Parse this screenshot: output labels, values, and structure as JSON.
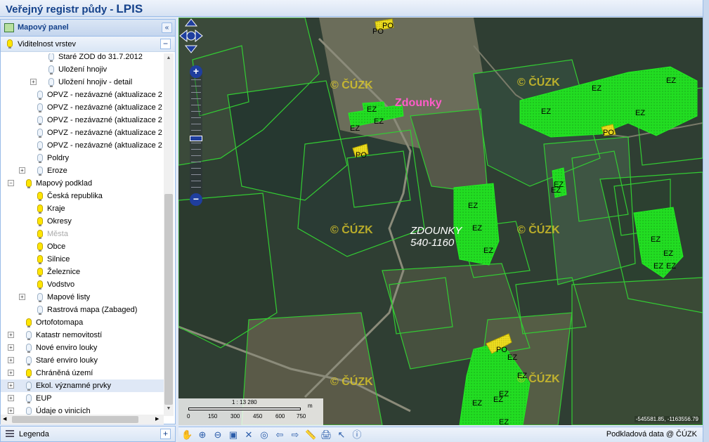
{
  "header": {
    "title_prefix": "Veřejný registr půdy -",
    "title_suffix": "LPIS"
  },
  "map_panel": {
    "title": "Mapový panel",
    "collapse": "«"
  },
  "layers": {
    "title": "Viditelnost vrstev",
    "collapse": "−"
  },
  "tree": [
    {
      "label": "Staré ZOD do 31.7.2012",
      "indent": 82,
      "bulb": "off",
      "exp": ""
    },
    {
      "label": "Uložení hnojiv",
      "indent": 82,
      "bulb": "off",
      "exp": ""
    },
    {
      "label": "Uložení hnojiv - detail",
      "indent": 82,
      "bulb": "off",
      "exp": "+"
    },
    {
      "label": "OPVZ - nezávazné (aktualizace 2",
      "indent": 66,
      "bulb": "off",
      "exp": ""
    },
    {
      "label": "OPVZ - nezávazné (aktualizace 2",
      "indent": 66,
      "bulb": "off",
      "exp": ""
    },
    {
      "label": "OPVZ - nezávazné (aktualizace 2",
      "indent": 66,
      "bulb": "off",
      "exp": ""
    },
    {
      "label": "OPVZ - nezávazné (aktualizace 2",
      "indent": 66,
      "bulb": "off",
      "exp": ""
    },
    {
      "label": "OPVZ - nezávazné (aktualizace 2",
      "indent": 66,
      "bulb": "off",
      "exp": ""
    },
    {
      "label": "Poldry",
      "indent": 66,
      "bulb": "off",
      "exp": ""
    },
    {
      "label": "Eroze",
      "indent": 66,
      "bulb": "off",
      "exp": "+"
    },
    {
      "label": "Mapový podklad",
      "indent": 50,
      "bulb": "on",
      "exp": "−"
    },
    {
      "label": "Česká republika",
      "indent": 66,
      "bulb": "on",
      "exp": ""
    },
    {
      "label": "Kraje",
      "indent": 66,
      "bulb": "on",
      "exp": ""
    },
    {
      "label": "Okresy",
      "indent": 66,
      "bulb": "on",
      "exp": ""
    },
    {
      "label": "Města",
      "indent": 66,
      "bulb": "on",
      "exp": "",
      "dim": true
    },
    {
      "label": "Obce",
      "indent": 66,
      "bulb": "on",
      "exp": ""
    },
    {
      "label": "Silnice",
      "indent": 66,
      "bulb": "on",
      "exp": ""
    },
    {
      "label": "Železnice",
      "indent": 66,
      "bulb": "on",
      "exp": ""
    },
    {
      "label": "Vodstvo",
      "indent": 66,
      "bulb": "on",
      "exp": ""
    },
    {
      "label": "Mapové listy",
      "indent": 66,
      "bulb": "off",
      "exp": "+"
    },
    {
      "label": "Rastrová mapa (Zabaged)",
      "indent": 66,
      "bulb": "off",
      "exp": ""
    },
    {
      "label": "Ortofotomapa",
      "indent": 50,
      "bulb": "on",
      "exp": ""
    },
    {
      "label": "Katastr nemovitostí",
      "indent": 50,
      "bulb": "off",
      "exp": "+"
    },
    {
      "label": "Nové enviro louky",
      "indent": 50,
      "bulb": "off",
      "exp": "+"
    },
    {
      "label": "Staré enviro louky",
      "indent": 50,
      "bulb": "off",
      "exp": "+"
    },
    {
      "label": "Chráněná území",
      "indent": 50,
      "bulb": "on",
      "exp": "+"
    },
    {
      "label": "Ekol. významné prvky",
      "indent": 50,
      "bulb": "off",
      "exp": "+",
      "selected": true
    },
    {
      "label": "EUP",
      "indent": 50,
      "bulb": "off",
      "exp": "+"
    },
    {
      "label": "Údaje o vinicích",
      "indent": 50,
      "bulb": "off",
      "exp": "+"
    }
  ],
  "legend": {
    "title": "Legenda",
    "expand": "+"
  },
  "map": {
    "town_label": "Zdounky",
    "parcel_name": "ZDOUNKY",
    "parcel_code": "540-1160",
    "watermark": "© ČÚZK",
    "ez": "EZ",
    "po": "PO",
    "scale": "1 : 13 280",
    "scale_unit": "m",
    "scale_ticks": [
      "0",
      "150",
      "300",
      "450",
      "600",
      "750"
    ],
    "coords": "-545581.85, -1163556.79",
    "zoom_in": "+",
    "zoom_out": "−"
  },
  "toolbar": {
    "copyright": "Podkladová data @ ČÚZK"
  },
  "colors": {
    "parcel_green": "#22dd22",
    "parcel_outline": "#33cc33",
    "po_yellow": "#f0e020",
    "header_text": "#15428b"
  }
}
